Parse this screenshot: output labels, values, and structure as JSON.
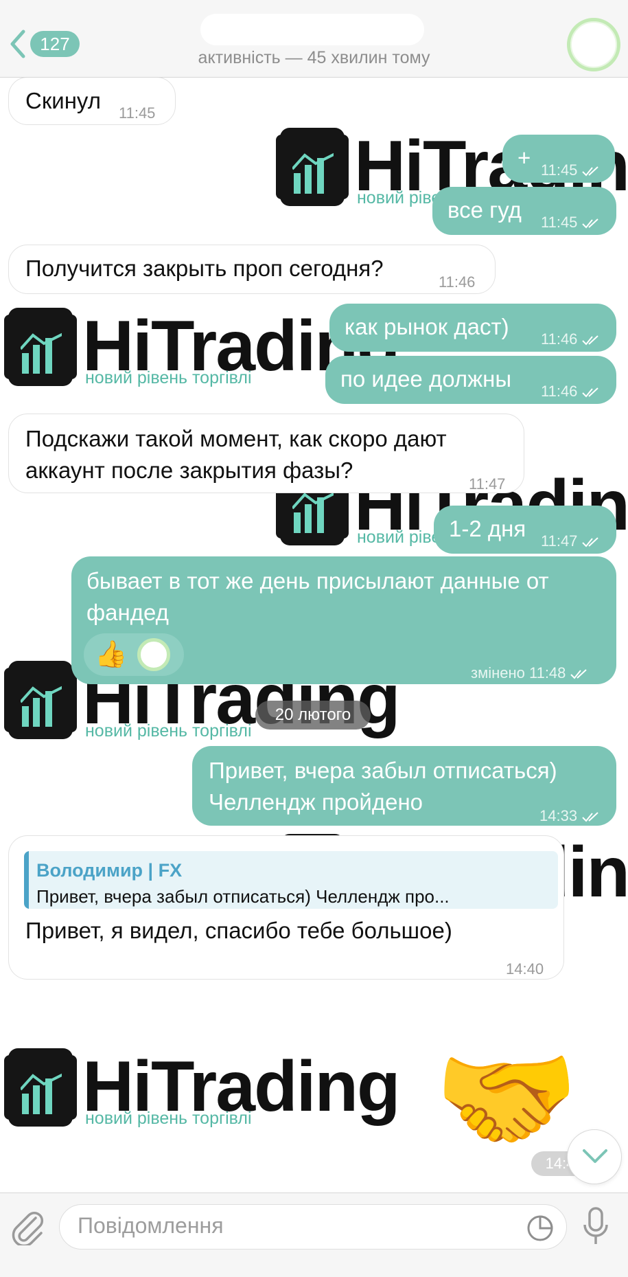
{
  "header": {
    "back_count": "127",
    "status": "активність — 45 хвилин тому"
  },
  "wallpaper": {
    "logo_word": "HiTrading",
    "logo_tagline": "новий рівень торгівлі",
    "brand_color": "#55b8a5"
  },
  "messages": [
    {
      "dir": "in",
      "text": "Скинул",
      "time": "11:45"
    },
    {
      "dir": "out",
      "text": "+",
      "time": "11:45"
    },
    {
      "dir": "out",
      "text": "все гуд",
      "time": "11:45"
    },
    {
      "dir": "in",
      "text": "Получится закрыть проп сегодня?",
      "time": "11:46"
    },
    {
      "dir": "out",
      "text": "как рынок даст)",
      "time": "11:46"
    },
    {
      "dir": "out",
      "text": "по идее должны",
      "time": "11:46"
    },
    {
      "dir": "in",
      "lines": [
        "Подскажи такой момент, как скоро дают",
        "аккаунт после закрытия фазы?"
      ],
      "time": "11:47"
    },
    {
      "dir": "out",
      "text": "1-2 дня",
      "time": "11:47"
    },
    {
      "dir": "out",
      "lines": [
        "бывает в тот же день присылают данные от",
        "фандед"
      ],
      "time": "змінено 11:48",
      "reaction": "👍"
    },
    {
      "dir": "out",
      "lines": [
        "Привет, вчера забыл отписаться)",
        "Челлендж пройдено"
      ],
      "time": "14:33"
    },
    {
      "dir": "in",
      "reply_name": "Володимир | FX",
      "reply_text": "Привет, вчера забыл отписаться) Челлендж про...",
      "text": "Привет, я видел, спасибо тебе большое)",
      "time": "14:40"
    }
  ],
  "date_separator": "20 лютого",
  "sticker": {
    "emoji": "🤝",
    "time": "14:4"
  },
  "input": {
    "placeholder": "Повідомлення"
  },
  "colors": {
    "accent": "#7cc5b6",
    "incoming": "#ffffff",
    "date_pill": "#5f5f5f"
  }
}
